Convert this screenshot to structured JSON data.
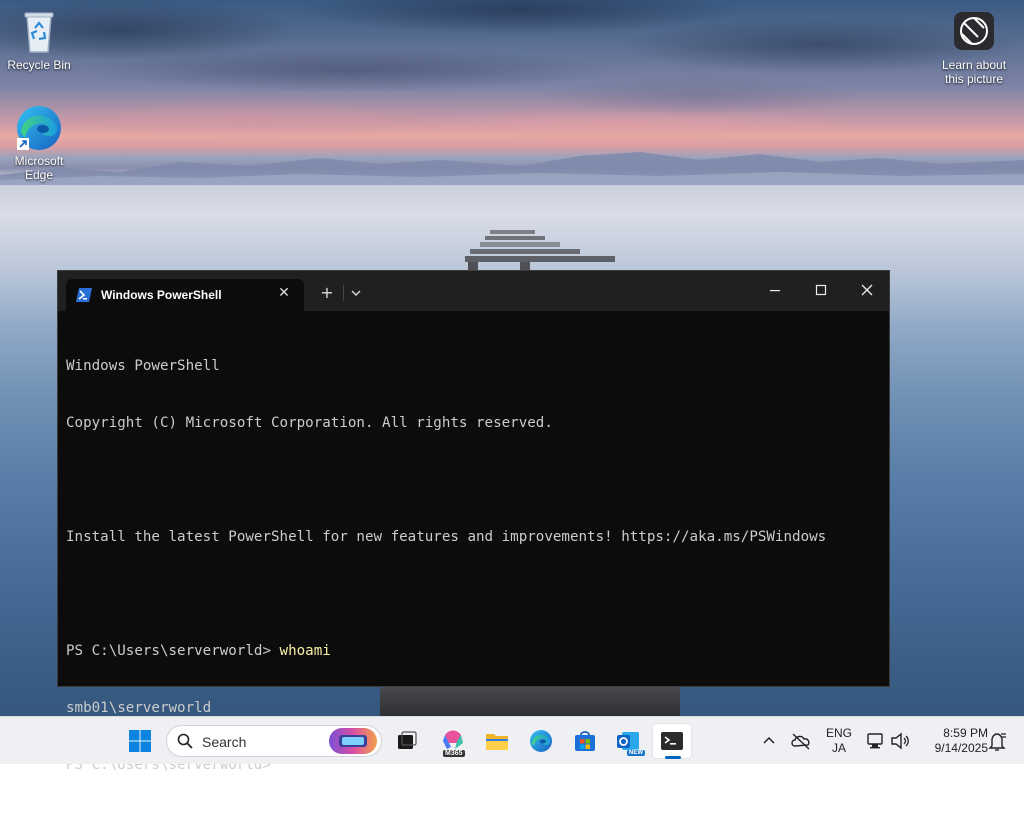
{
  "desktop": {
    "icons": [
      {
        "label": "Recycle Bin",
        "icon": "recycle-bin-icon"
      },
      {
        "label": "Microsoft Edge",
        "icon": "edge-icon"
      },
      {
        "label": "Learn about this picture",
        "icon": "camera-icon"
      }
    ]
  },
  "terminal": {
    "tab_title": "Windows PowerShell",
    "lines": [
      {
        "text": "Windows PowerShell"
      },
      {
        "text": "Copyright (C) Microsoft Corporation. All rights reserved."
      },
      {
        "text": ""
      },
      {
        "text": "Install the latest PowerShell for new features and improvements! https://aka.ms/PSWindows"
      },
      {
        "text": ""
      },
      {
        "prompt": "PS C:\\Users\\serverworld> ",
        "command": "whoami"
      },
      {
        "text": "smb01\\serverworld"
      },
      {
        "prompt": "PS C:\\Users\\serverworld> ",
        "command": ""
      }
    ]
  },
  "taskbar": {
    "search_placeholder": "Search",
    "apps": [
      {
        "name": "start",
        "icon": "windows-logo-icon"
      },
      {
        "name": "task-view",
        "icon": "task-view-icon"
      },
      {
        "name": "microsoft-365",
        "icon": "m365-icon",
        "badge": "M365"
      },
      {
        "name": "file-explorer",
        "icon": "folder-icon"
      },
      {
        "name": "edge",
        "icon": "edge-icon"
      },
      {
        "name": "store",
        "icon": "store-icon"
      },
      {
        "name": "outlook",
        "icon": "outlook-icon",
        "badge": "NEW"
      },
      {
        "name": "terminal",
        "icon": "terminal-icon",
        "active": true
      }
    ],
    "tray": {
      "language_top": "ENG",
      "language_bottom": "JA",
      "time": "8:59 PM",
      "date": "9/14/2025"
    }
  },
  "colors": {
    "terminal_bg": "#0c0c0c",
    "titlebar_bg": "#202020",
    "command_color": "#f9f1a5",
    "taskbar_bg": "#eef0f4",
    "accent": "#0067c0"
  }
}
